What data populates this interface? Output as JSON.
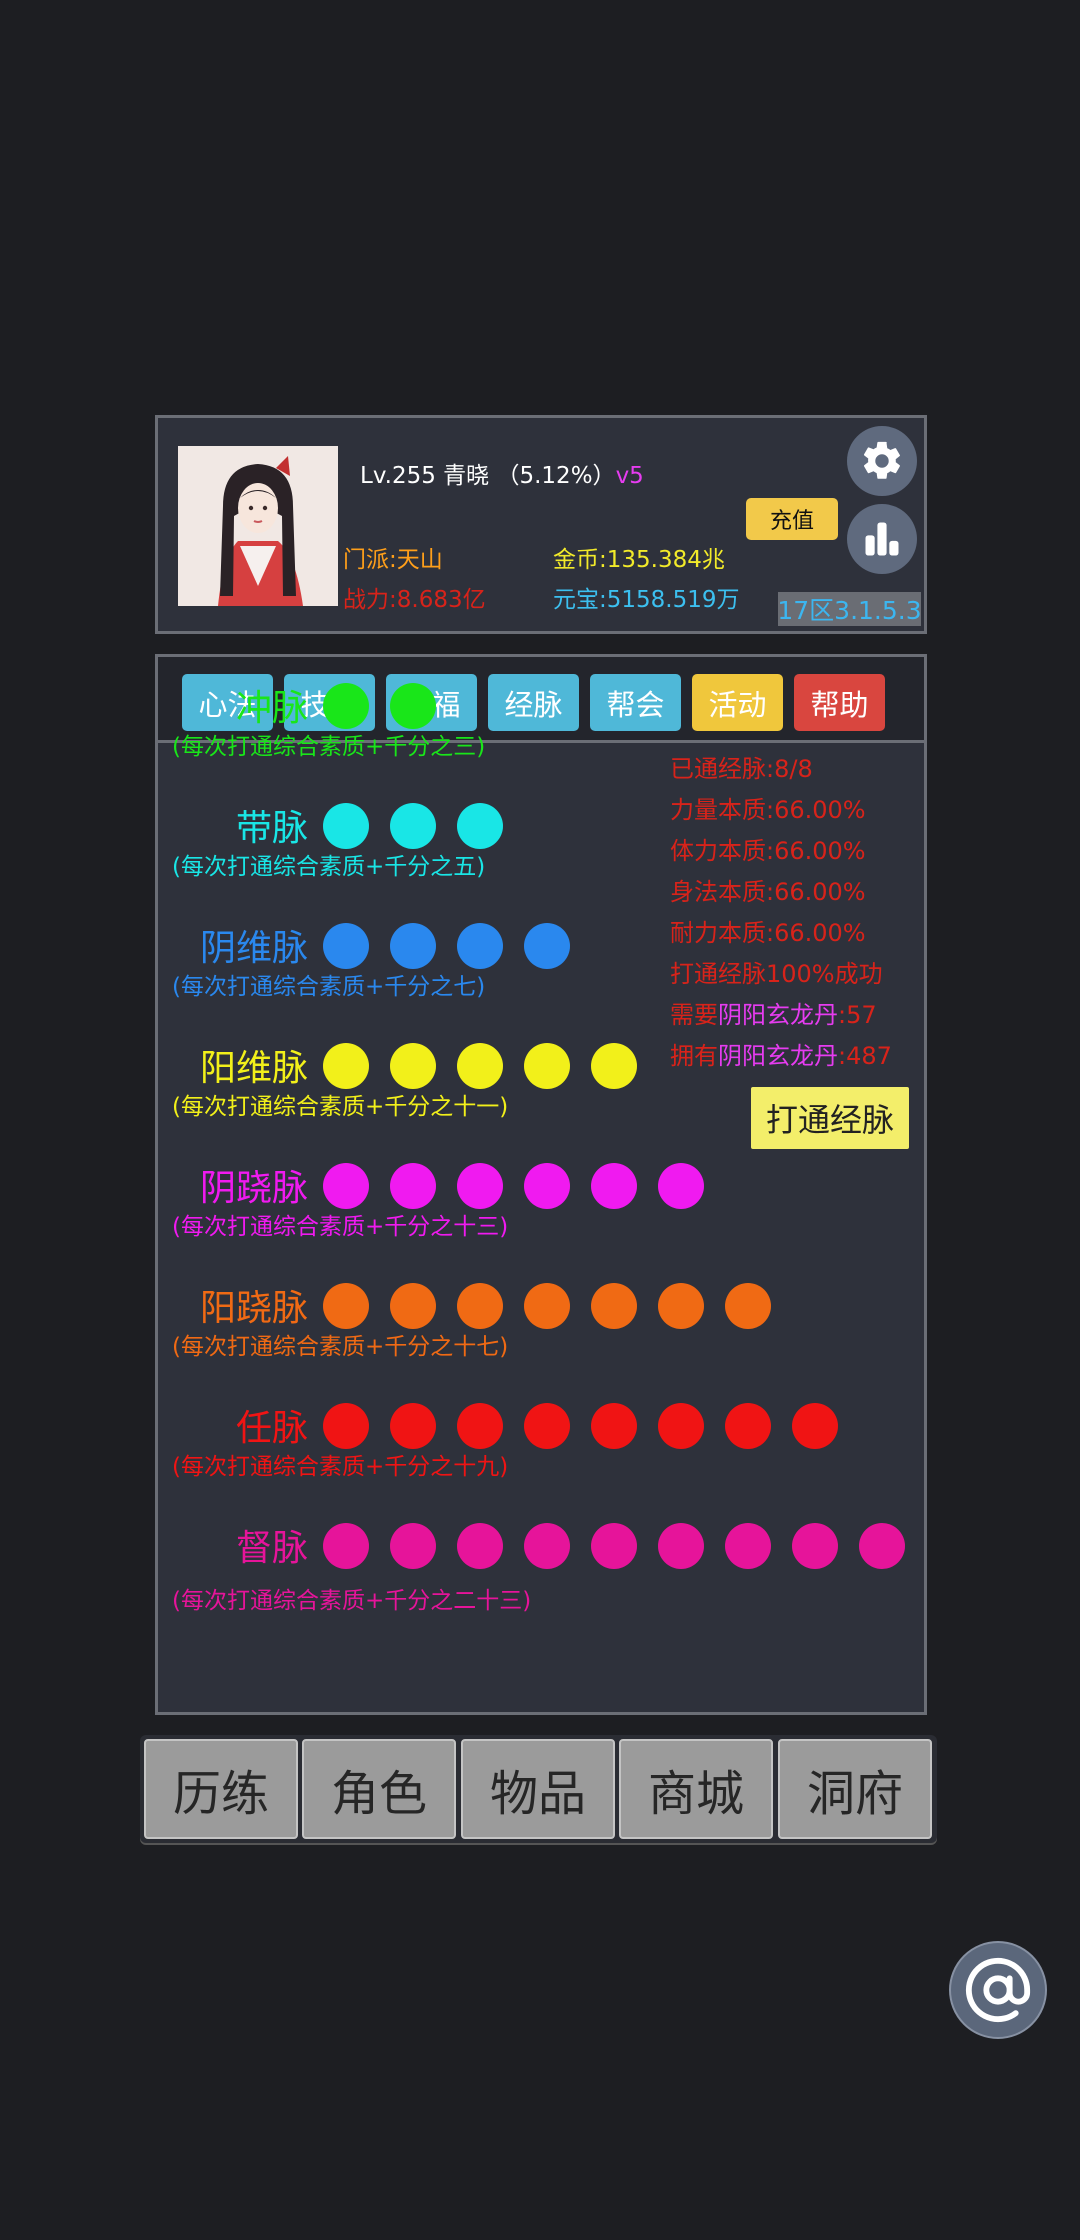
{
  "header": {
    "level": "Lv.255",
    "name": "青晓",
    "progress": "（5.12%）",
    "vip": "v5",
    "sect": "门派:天山",
    "power": "战力:8.683亿",
    "gold": "金币:135.384兆",
    "yuanbao": "元宝:5158.519万",
    "recharge_label": "充值",
    "server": "17区3.1.5.3",
    "settings_icon": "gear-icon",
    "stats_icon": "bar-chart-icon"
  },
  "tabs": [
    {
      "label": "心法",
      "color": "#4fb8d8"
    },
    {
      "label": "技能",
      "color": "#4fb8d8"
    },
    {
      "label": "祝福",
      "color": "#4fb8d8"
    },
    {
      "label": "经脉",
      "color": "#4fb8d8"
    },
    {
      "label": "帮会",
      "color": "#4fb8d8"
    },
    {
      "label": "活动",
      "color": "#f0c73c"
    },
    {
      "label": "帮助",
      "color": "#d9463f"
    }
  ],
  "meridians": [
    {
      "name": "冲脉",
      "desc": "(每次打通综合素质+千分之三)",
      "color": "#19e619",
      "dots": 2
    },
    {
      "name": "带脉",
      "desc": "(每次打通综合素质+千分之五)",
      "color": "#19e6e6",
      "dots": 3
    },
    {
      "name": "阴维脉",
      "desc": "(每次打通综合素质+千分之七)",
      "color": "#2a88ee",
      "dots": 4
    },
    {
      "name": "阳维脉",
      "desc": "(每次打通综合素质+千分之十一)",
      "color": "#f2f01a",
      "dots": 5
    },
    {
      "name": "阴跷脉",
      "desc": "(每次打通综合素质+千分之十三)",
      "color": "#f01af0",
      "dots": 6
    },
    {
      "name": "阳跷脉",
      "desc": "(每次打通综合素质+千分之十七)",
      "color": "#f06a14",
      "dots": 7
    },
    {
      "name": "任脉",
      "desc": "(每次打通综合素质+千分之十九)",
      "color": "#f01414",
      "dots": 8
    },
    {
      "name": "督脉",
      "desc": "(每次打通综合素质+千分之二十三)",
      "color": "#e6149a",
      "dots": 9
    }
  ],
  "stats": {
    "opened": "已通经脉:8/8",
    "strength": "力量本质:66.00%",
    "stamina": "体力本质:66.00%",
    "agility": "身法本质:66.00%",
    "endurance": "耐力本质:66.00%",
    "success": "打通经脉100%成功",
    "need_prefix": "需要",
    "need_item": "阴阳玄龙丹",
    "need_value": ":57",
    "own_prefix": "拥有",
    "own_item": "阴阳玄龙丹",
    "own_value": ":487"
  },
  "open_button": "打通经脉",
  "nav": [
    "历练",
    "角色",
    "物品",
    "商城",
    "洞府"
  ],
  "at_icon": "at-sign-icon"
}
